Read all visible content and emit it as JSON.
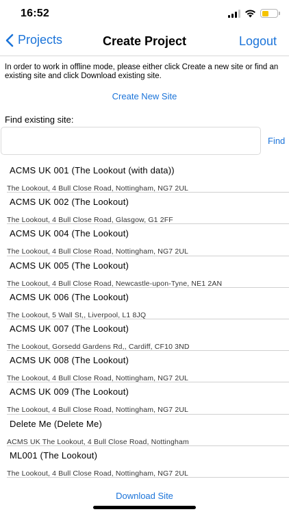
{
  "status": {
    "time": "16:52"
  },
  "nav": {
    "back_label": "Projects",
    "title": "Create Project",
    "logout_label": "Logout"
  },
  "intro_text": "In order to work in offline mode, please either click Create a new site or find an existing site and click Download existing site.",
  "create_label": "Create New Site",
  "find": {
    "label": "Find existing site:",
    "value": "",
    "placeholder": "",
    "button_label": "Find"
  },
  "sites": [
    {
      "name": "ACMS UK 001 (The Lookout (with data))",
      "address": "The Lookout, 4 Bull Close Road, Nottingham, NG7 2UL"
    },
    {
      "name": "ACMS UK 002 (The Lookout)",
      "address": "The Lookout, 4 Bull Close Road, Glasgow, G1 2FF"
    },
    {
      "name": "ACMS UK 004 (The Lookout)",
      "address": "The Lookout, 4 Bull Close Road, Nottingham, NG7 2UL"
    },
    {
      "name": "ACMS UK 005 (The Lookout)",
      "address": "The Lookout, 4 Bull Close Road, Newcastle-upon-Tyne, NE1 2AN"
    },
    {
      "name": "ACMS UK 006 (The Lookout)",
      "address": "The Lookout, 5 Wall St,, Liverpool, L1 8JQ"
    },
    {
      "name": "ACMS UK 007 (The Lookout)",
      "address": "The Lookout, Gorsedd Gardens Rd,, Cardiff, CF10 3ND"
    },
    {
      "name": "ACMS UK 008 (The Lookout)",
      "address": "The Lookout, 4 Bull Close Road, Nottingham, NG7 2UL"
    },
    {
      "name": "ACMS UK 009 (The Lookout)",
      "address": "The Lookout, 4 Bull Close Road, Nottingham, NG7 2UL"
    },
    {
      "name": "Delete Me (Delete Me)",
      "address": "ACMS UK The Lookout, 4 Bull Close Road, Nottingham"
    },
    {
      "name": "ML001 (The Lookout)",
      "address": "The Lookout, 4 Bull Close Road, Nottingham, NG7 2UL"
    }
  ],
  "download_label": "Download Site",
  "colors": {
    "accent": "#1a73d9",
    "battery": "#f5c400"
  },
  "icons": {
    "back": "chevron-left-icon",
    "signal": "cellular-signal-icon",
    "wifi": "wifi-icon",
    "battery": "battery-icon"
  }
}
